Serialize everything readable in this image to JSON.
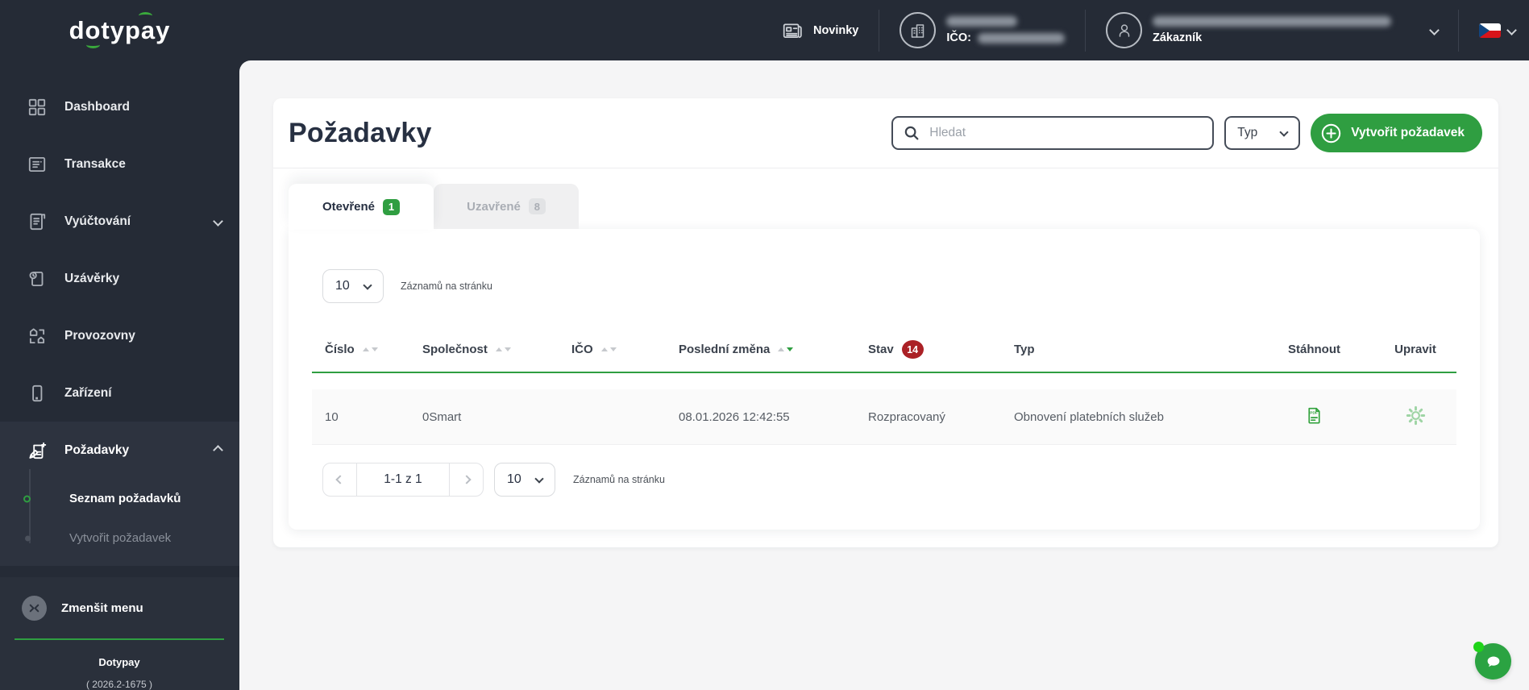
{
  "brand": {
    "logo": "dotypay",
    "footer_name": "Dotypay",
    "footer_version": "( 2026.2-1675 )"
  },
  "topbar": {
    "news": "Novinky",
    "company_ico_label": "IČO:",
    "customer_label": "Zákazník"
  },
  "sidebar": {
    "collapse": "Zmenšit menu",
    "items": [
      {
        "label": "Dashboard"
      },
      {
        "label": "Transakce"
      },
      {
        "label": "Vyúčtování"
      },
      {
        "label": "Uzávěrky"
      },
      {
        "label": "Provozovny"
      },
      {
        "label": "Zařízení"
      },
      {
        "label": "Požadavky"
      }
    ],
    "submenu": [
      {
        "label": "Seznam požadavků"
      },
      {
        "label": "Vytvořit požadavek"
      }
    ]
  },
  "page": {
    "title": "Požadavky",
    "search_placeholder": "Hledat",
    "type_filter": "Typ",
    "create_button": "Vytvořit požadavek"
  },
  "tabs": [
    {
      "label": "Otevřené",
      "count": "1"
    },
    {
      "label": "Uzavřené",
      "count": "8"
    }
  ],
  "list": {
    "per_page_top": "10",
    "per_page_label_top": "Záznamů na stránku",
    "columns": [
      "Číslo",
      "Společnost",
      "IČO",
      "Poslední změna",
      "Stav",
      "Typ",
      "Stáhnout",
      "Upravit"
    ],
    "stav_count": "14",
    "rows": [
      {
        "cislo": "10",
        "spolecnost": "0Smart",
        "posledni_zmena": "08.01.2026 12:42:55",
        "stav": "Rozpracovaný",
        "typ": "Obnovení platebních služeb"
      }
    ],
    "pagination_range": "1-1 z 1",
    "per_page_bottom": "10",
    "per_page_label_bottom": "Záznamů na stránku"
  },
  "colors": {
    "accent_green": "#2f9e41",
    "badge_red": "#ab2126",
    "dark_bg": "#252b36",
    "content_bg": "#f5f5f6"
  },
  "icons": {
    "news-icon": "newspaper outline",
    "company-icon": "buildings in circle",
    "customer-icon": "person in circle",
    "language-flag-icon": "czech flag",
    "dashboard-icon": "2x2 grid",
    "transactions-icon": "list document",
    "billing-icon": "receipt",
    "closures-icon": "document with clock",
    "locations-icon": "two shops",
    "devices-icon": "payment terminal",
    "requests-icon": "document with pencil and plus",
    "collapse-menu-icon": "inward chevrons in circle",
    "search-icon": "magnifier",
    "plus-circle-icon": "plus in circle",
    "sort-icons": "up/down triangles",
    "pdf-download-icon": "green PDF document",
    "edit-gear-icon": "light green gear",
    "chat-icon": "speech bubble"
  }
}
